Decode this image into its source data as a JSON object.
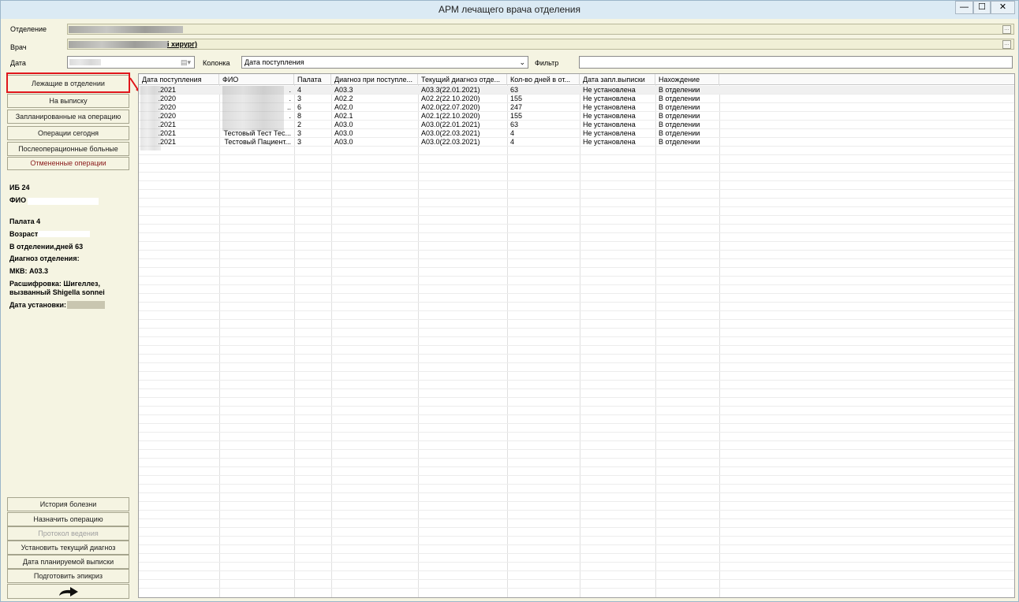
{
  "window": {
    "title": "АРМ лечащего врача отделения",
    "minimize_label": "—",
    "maximize_label": "☐",
    "close_label": "✕"
  },
  "filters": {
    "department_label": "Отделение",
    "doctor_label": "Врач",
    "doctor_value_suffix": "і хирург)",
    "date_label": "Дата",
    "column_label": "Колонка",
    "column_value": "Дата поступления",
    "filter_label": "Фильтр",
    "filter_value": ""
  },
  "nav": {
    "items": [
      {
        "label": "Лежащие в отделении",
        "state": "active"
      },
      {
        "label": "На выписку",
        "state": "normal"
      },
      {
        "label": "Запланированные на операцию",
        "state": "normal"
      },
      {
        "label": "Операции сегодня",
        "state": "normal"
      },
      {
        "label": "Послеоперационные больные",
        "state": "normal"
      },
      {
        "label": "Отмененные операции",
        "state": "red"
      }
    ],
    "bottom_items": [
      {
        "label": "История болезни",
        "state": "normal"
      },
      {
        "label": "Назначить операцию",
        "state": "normal"
      },
      {
        "label": "Протокол ведения",
        "state": "disabled"
      },
      {
        "label": "Установить текущий диагноз",
        "state": "normal"
      },
      {
        "label": "Дата планируемой выписки",
        "state": "normal"
      },
      {
        "label": "Подготовить эпикриз",
        "state": "normal"
      }
    ],
    "exit_icon": "arrow-right-icon"
  },
  "patient_info": {
    "ib": "ИБ 24",
    "fio_label": "ФИО",
    "ward": "Палата 4",
    "age_label": "Возраст",
    "days": "В отделении,дней 63",
    "dept_diag": "Диагноз отделения:",
    "mkb": "МКВ: А03.3",
    "decoding_line1": "Расшифровка: Шигеллез,",
    "decoding_line2": "вызванный Shigella sonnei",
    "set_date_label": "Дата установки: 2"
  },
  "table": {
    "columns": [
      "Дата поступления",
      "ФИО",
      "Палата",
      "Диагноз при поступле...",
      "Текущий диагноз отде...",
      "Кол-во дней в от...",
      "Дата запл.выписки",
      "Нахождение"
    ],
    "rows": [
      [
        ".2021",
        ".",
        "4",
        "А03.3",
        "А03.3(22.01.2021)",
        "63",
        "Не установлена",
        "В отделении"
      ],
      [
        ".2020",
        ".",
        "3",
        "А02.2",
        "А02.2(22.10.2020)",
        "155",
        "Не установлена",
        "В отделении"
      ],
      [
        ".2020",
        "..",
        "6",
        "А02.0",
        "А02.0(22.07.2020)",
        "247",
        "Не установлена",
        "В отделении"
      ],
      [
        ".2020",
        ".",
        "8",
        "А02.1",
        "А02.1(22.10.2020)",
        "155",
        "Не установлена",
        "В отделении"
      ],
      [
        ".2021",
        "",
        "2",
        "А03.0",
        "А03.0(22.01.2021)",
        "63",
        "Не установлена",
        "В отделении"
      ],
      [
        ".2021",
        "Тестовый Тест Тес...",
        "3",
        "А03.0",
        "А03.0(22.03.2021)",
        "4",
        "Не установлена",
        "В отделении"
      ],
      [
        ".2021",
        "Тестовый Пациент...",
        "3",
        "А03.0",
        "А03.0(22.03.2021)",
        "4",
        "Не установлена",
        "В отделении"
      ]
    ]
  },
  "colors": {
    "panel": "#f5f4e2",
    "active": "#e8e1b8",
    "highlight": "#e0161b"
  }
}
